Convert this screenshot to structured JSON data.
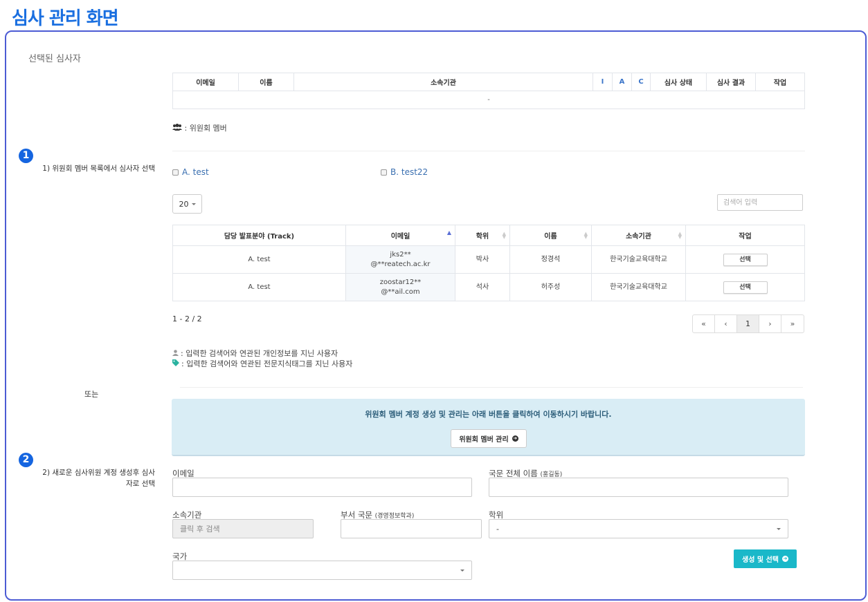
{
  "page_title": "심사 관리 화면",
  "section_title": "선택된 심사자",
  "selected_table": {
    "headers": [
      "이메일",
      "이름",
      "소속기관",
      "I",
      "A",
      "C",
      "심사 상태",
      "심사 결과",
      "작업"
    ],
    "empty_text": "-"
  },
  "committee_legend": ": 위원회 멤버",
  "step1": {
    "badge": "1",
    "label": "1) 위원회 멤버 목록에서 심사자 선택"
  },
  "tracks": [
    "A. test",
    "B. test22"
  ],
  "page_size": "20",
  "search_placeholder": "검색어 입력",
  "list_table": {
    "headers": [
      "담당 발표분야 (Track)",
      "이메일",
      "학위",
      "이름",
      "소속기관",
      "작업"
    ],
    "rows": [
      {
        "track": "A. test",
        "email_line1": "jks2**",
        "email_line2": "@**reatech.ac.kr",
        "degree": "박사",
        "name": "정경석",
        "org": "한국기술교육대학교",
        "action": "선택"
      },
      {
        "track": "A. test",
        "email_line1": "zoostar12**",
        "email_line2": "@**ail.com",
        "degree": "석사",
        "name": "허주성",
        "org": "한국기술교육대학교",
        "action": "선택"
      }
    ]
  },
  "count_text": "1 - 2 / 2",
  "pager": [
    "«",
    "‹",
    "1",
    "›",
    "»"
  ],
  "notes": {
    "personal": ": 입력한 검색어와 연관된 개인정보를 지닌 사용자",
    "tag": ": 입력한 검색어와 연관된 전문지식태그를 지닌 사용자"
  },
  "or_text": "또는",
  "info_box": {
    "text": "위원회 멤버 계정 생성 및 관리는 아래 버튼을 클릭하여 이동하시기 바랍니다.",
    "button": "위원회 멤버 관리"
  },
  "step2": {
    "badge": "2",
    "label_line1": "2) 새로운 심사위원 계정 생성후 심사",
    "label_line2": "자로 선택"
  },
  "form": {
    "email_label": "이메일",
    "name_label": "국문 전체 이름",
    "name_hint": "(홍길동)",
    "org_label": "소속기관",
    "org_placeholder": "클릭 후 검색",
    "dept_label": "부서 국문",
    "dept_hint": "(경영정보학과)",
    "degree_label": "학위",
    "degree_value": "-",
    "country_label": "국가",
    "country_value": "",
    "submit": "생성 및 선택"
  },
  "colors": {
    "accent": "#1a6fe0",
    "frame": "#4c5bd4",
    "info_bg": "#d9edf5",
    "submit_bg": "#1ab8c9"
  }
}
